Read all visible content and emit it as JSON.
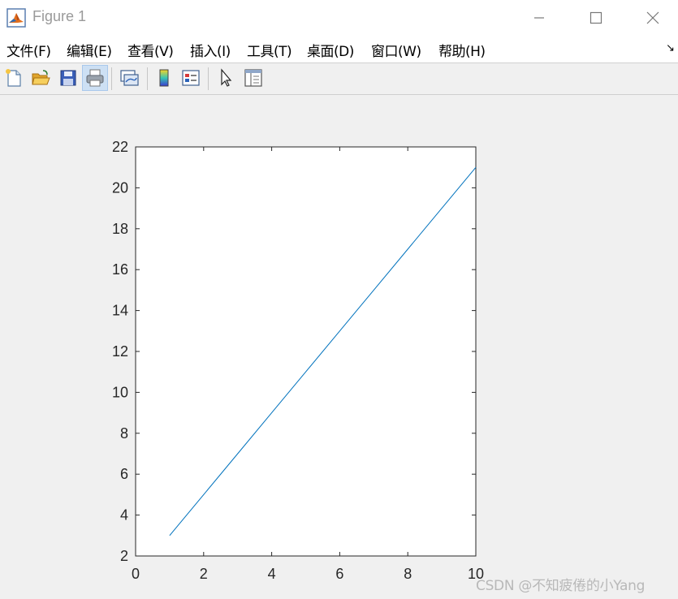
{
  "window": {
    "title": "Figure 1",
    "controls": {
      "minimize": "minimize",
      "maximize": "maximize",
      "close": "close"
    }
  },
  "menubar": {
    "items": [
      {
        "label": "文件(F)"
      },
      {
        "label": "编辑(E)"
      },
      {
        "label": "查看(V)"
      },
      {
        "label": "插入(I)"
      },
      {
        "label": "工具(T)"
      },
      {
        "label": "桌面(D)"
      },
      {
        "label": "窗口(W)"
      },
      {
        "label": "帮助(H)"
      }
    ],
    "overflow_icon": "dock-arrow-icon"
  },
  "toolbar": {
    "buttons": [
      {
        "icon": "new-figure-icon"
      },
      {
        "icon": "open-file-icon"
      },
      {
        "icon": "save-icon"
      },
      {
        "icon": "print-icon",
        "active": true
      },
      {
        "icon": "link-plot-icon"
      },
      {
        "icon": "insert-colorbar-icon"
      },
      {
        "icon": "insert-legend-icon"
      },
      {
        "icon": "edit-plot-icon"
      },
      {
        "icon": "property-inspector-icon"
      }
    ]
  },
  "chart_data": {
    "type": "line",
    "title": "",
    "xlabel": "",
    "ylabel": "",
    "xlim": [
      0,
      10
    ],
    "ylim": [
      2,
      22
    ],
    "xticks": [
      0,
      2,
      4,
      6,
      8,
      10
    ],
    "yticks": [
      2,
      4,
      6,
      8,
      10,
      12,
      14,
      16,
      18,
      20,
      22
    ],
    "grid": false,
    "series": [
      {
        "color": "#0072bd",
        "x": [
          1,
          2,
          3,
          4,
          5,
          6,
          7,
          8,
          9,
          10
        ],
        "y": [
          3,
          5,
          7,
          9,
          11,
          13,
          15,
          17,
          19,
          21
        ]
      }
    ]
  },
  "watermark": "CSDN @不知疲倦的小Yang"
}
